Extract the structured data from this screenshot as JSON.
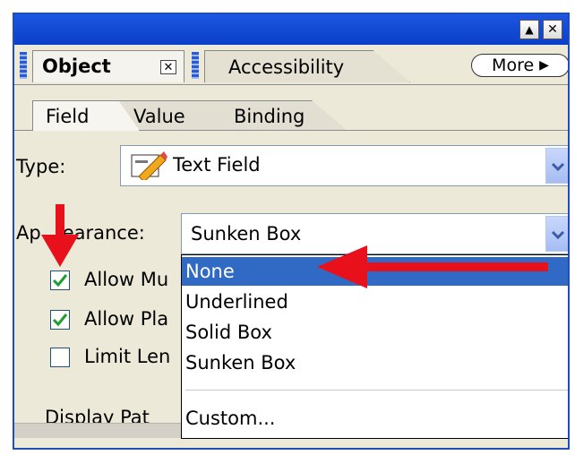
{
  "window": {
    "minimize_glyph": "▲",
    "close_glyph": "✕"
  },
  "tabs": {
    "object_label": "Object",
    "object_close_glyph": "✕",
    "accessibility_label": "Accessibility",
    "more_label": "More",
    "more_arrow": "▶"
  },
  "subtabs": [
    "Field",
    "Value",
    "Binding"
  ],
  "type_row": {
    "label": "Type:",
    "value": "Text Field"
  },
  "appearance_row": {
    "label_visible": "Ap",
    "label_rest": "earance:",
    "value": "Sunken Box"
  },
  "checkboxes": [
    {
      "label": "Allow Mu",
      "checked": true
    },
    {
      "label": "Allow Pla",
      "checked": true
    },
    {
      "label": "Limit Len",
      "checked": false
    }
  ],
  "display_pattern_label": "Display Pat",
  "dropdown": {
    "items": [
      "None",
      "Underlined",
      "Solid Box",
      "Sunken Box"
    ],
    "custom_item": "Custom...",
    "selected_index": 0
  },
  "colors": {
    "titlebar": "#0a3fc9",
    "selected_row": "#316ac5",
    "annotation_arrow": "#e8101a",
    "checkmark": "#1e9e2c"
  }
}
